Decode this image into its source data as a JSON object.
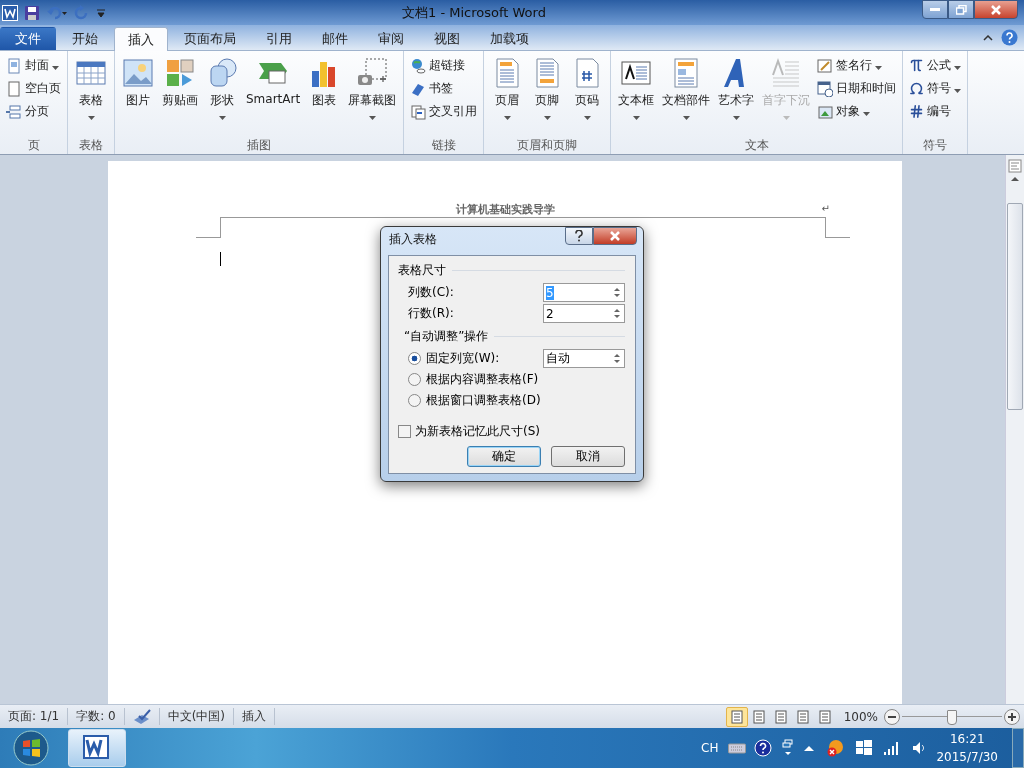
{
  "window": {
    "title": "文档1  -  Microsoft Word"
  },
  "tabs": [
    {
      "label": "文件",
      "kind": "file",
      "selected": false
    },
    {
      "label": "开始",
      "kind": "tab",
      "selected": false
    },
    {
      "label": "插入",
      "kind": "tab",
      "selected": true
    },
    {
      "label": "页面布局",
      "kind": "tab",
      "selected": false
    },
    {
      "label": "引用",
      "kind": "tab",
      "selected": false
    },
    {
      "label": "邮件",
      "kind": "tab",
      "selected": false
    },
    {
      "label": "审阅",
      "kind": "tab",
      "selected": false
    },
    {
      "label": "视图",
      "kind": "tab",
      "selected": false
    },
    {
      "label": "加载项",
      "kind": "tab",
      "selected": false
    }
  ],
  "ribbon": {
    "groups": [
      {
        "label": "页",
        "items": [
          {
            "label": "封面",
            "kind": "small",
            "dropdown": true,
            "disabled": false
          },
          {
            "label": "空白页",
            "kind": "small",
            "dropdown": false,
            "disabled": false
          },
          {
            "label": "分页",
            "kind": "small",
            "dropdown": false,
            "disabled": false
          }
        ]
      },
      {
        "label": "表格",
        "items": [
          {
            "label": "表格",
            "kind": "large",
            "dropdown": true,
            "disabled": false
          }
        ]
      },
      {
        "label": "插图",
        "items": [
          {
            "label": "图片",
            "kind": "large",
            "dropdown": false,
            "disabled": false
          },
          {
            "label": "剪贴画",
            "kind": "large",
            "dropdown": false,
            "disabled": false
          },
          {
            "label": "形状",
            "kind": "large",
            "dropdown": true,
            "disabled": false
          },
          {
            "label": "SmartArt",
            "kind": "large",
            "dropdown": false,
            "disabled": false
          },
          {
            "label": "图表",
            "kind": "large",
            "dropdown": false,
            "disabled": false
          },
          {
            "label": "屏幕截图",
            "kind": "large",
            "dropdown": true,
            "disabled": false
          }
        ]
      },
      {
        "label": "链接",
        "items": [
          {
            "label": "超链接",
            "kind": "small",
            "dropdown": false,
            "disabled": false
          },
          {
            "label": "书签",
            "kind": "small",
            "dropdown": false,
            "disabled": false
          },
          {
            "label": "交叉引用",
            "kind": "small",
            "dropdown": false,
            "disabled": false
          }
        ]
      },
      {
        "label": "页眉和页脚",
        "items": [
          {
            "label": "页眉",
            "kind": "large",
            "dropdown": true,
            "disabled": false
          },
          {
            "label": "页脚",
            "kind": "large",
            "dropdown": true,
            "disabled": false
          },
          {
            "label": "页码",
            "kind": "large",
            "dropdown": true,
            "disabled": false
          }
        ]
      },
      {
        "label": "文本",
        "items": [
          {
            "label": "文本框",
            "kind": "large",
            "dropdown": true,
            "disabled": false
          },
          {
            "label": "文档部件",
            "kind": "large",
            "dropdown": true,
            "disabled": false
          },
          {
            "label": "艺术字",
            "kind": "large",
            "dropdown": true,
            "disabled": false
          },
          {
            "label": "首字下沉",
            "kind": "large",
            "dropdown": true,
            "disabled": true
          },
          {
            "label": "签名行",
            "kind": "small",
            "dropdown": true,
            "disabled": false
          },
          {
            "label": "日期和时间",
            "kind": "small",
            "dropdown": false,
            "disabled": false
          },
          {
            "label": "对象",
            "kind": "small",
            "dropdown": true,
            "disabled": false
          }
        ]
      },
      {
        "label": "符号",
        "items": [
          {
            "label": "公式",
            "kind": "small",
            "dropdown": true,
            "disabled": false
          },
          {
            "label": "符号",
            "kind": "small",
            "dropdown": true,
            "disabled": false
          },
          {
            "label": "编号",
            "kind": "small",
            "dropdown": false,
            "disabled": false
          }
        ]
      }
    ]
  },
  "document": {
    "header_text": "计算机基础实践导学",
    "paragraph_mark": "↵"
  },
  "dialog": {
    "title": "插入表格",
    "size_section": "表格尺寸",
    "fields": [
      {
        "label": "列数(C):",
        "value": "5"
      },
      {
        "label": "行数(R):",
        "value": "2"
      }
    ],
    "autofit_section": "“自动调整”操作",
    "options": [
      {
        "label": "固定列宽(W):",
        "selected": true,
        "value": "自动"
      },
      {
        "label": "根据内容调整表格(F)",
        "selected": false
      },
      {
        "label": "根据窗口调整表格(D)",
        "selected": false
      }
    ],
    "remember": {
      "label": "为新表格记忆此尺寸(S)",
      "checked": false
    },
    "buttons": [
      {
        "label": "确定",
        "kind": "default"
      },
      {
        "label": "取消",
        "kind": "normal"
      }
    ]
  },
  "status_bar": {
    "items": [
      "页面: 1/1",
      "字数: 0",
      "中文(中国)",
      "插入"
    ],
    "views": [
      {
        "selected": true
      },
      {
        "selected": false
      },
      {
        "selected": false
      },
      {
        "selected": false
      },
      {
        "selected": false
      }
    ],
    "zoom": "100%",
    "zoom_slider": {
      "level": 0.5
    }
  },
  "taskbar": {
    "language": "CH",
    "time": "16:21",
    "date": "2015/7/30"
  }
}
